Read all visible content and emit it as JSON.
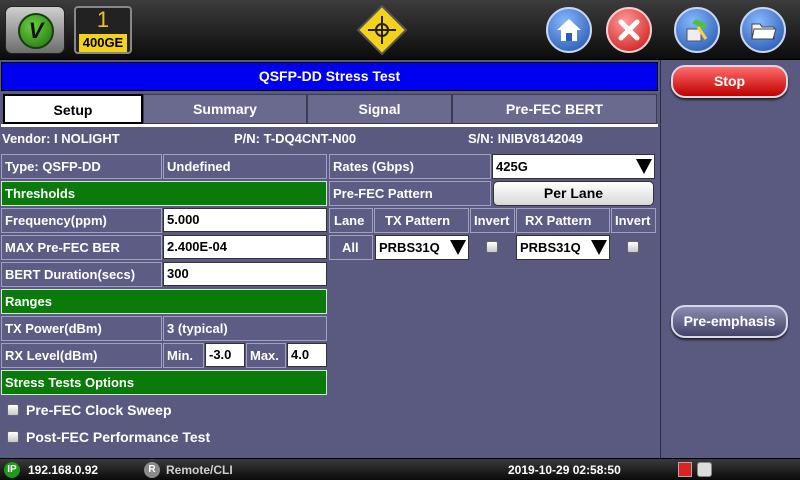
{
  "header": {
    "logo_letter": "V",
    "port_number": "1",
    "port_rate": "400GE"
  },
  "title": "QSFP-DD Stress Test",
  "tabs": [
    {
      "label": "Setup",
      "active": true
    },
    {
      "label": "Summary",
      "active": false
    },
    {
      "label": "Signal",
      "active": false
    },
    {
      "label": "Pre-FEC BERT",
      "active": false
    }
  ],
  "vendor_info": {
    "vendor": "Vendor: I NOLIGHT",
    "pn": "P/N: T-DQ4CNT-N00",
    "sn": "S/N: INIBV8142049"
  },
  "left_panel": {
    "type_label": "Type: QSFP-DD",
    "type_value": "Undefined",
    "thresholds_header": "Thresholds",
    "frequency_label": "Frequency(ppm)",
    "frequency_value": "5.000",
    "max_ber_label": "MAX Pre-FEC BER",
    "max_ber_value": "2.400E-04",
    "bert_duration_label": "BERT Duration(secs)",
    "bert_duration_value": "300",
    "ranges_header": "Ranges",
    "tx_power_label": "TX Power(dBm)",
    "tx_power_value": "3 (typical)",
    "rx_level_label": "RX Level(dBm)",
    "rx_min_label": "Min.",
    "rx_min_value": "-3.0",
    "rx_max_label": "Max.",
    "rx_max_value": "4.0",
    "stress_header": "Stress Tests Options",
    "options": [
      {
        "label": "Pre-FEC Clock Sweep",
        "checked": false
      },
      {
        "label": "Post-FEC Performance Test",
        "checked": false
      }
    ]
  },
  "right_grid": {
    "rates_label": "Rates (Gbps)",
    "rates_value": "425G",
    "pattern_label": "Pre-FEC Pattern",
    "pattern_button": "Per Lane",
    "col_lane": "Lane",
    "col_tx": "TX Pattern",
    "col_invert1": "Invert",
    "col_rx": "RX Pattern",
    "col_invert2": "Invert",
    "row_lane": "All",
    "row_tx": "PRBS31Q",
    "row_rx": "PRBS31Q"
  },
  "side_buttons": {
    "stop": "Stop",
    "preemphasis": "Pre-emphasis"
  },
  "status": {
    "ip_icon": "IP",
    "ip": "192.168.0.92",
    "remote_icon": "R",
    "remote": "Remote/CLI",
    "datetime": "2019-10-29  02:58:50"
  },
  "colors": {
    "title_blue": "#0000f0",
    "header_green": "#0a7a0a",
    "stop_red": "#c00000",
    "panel_bg": "#5a5a80"
  },
  "icons": [
    "home-icon",
    "close-icon",
    "tools-icon",
    "folder-icon",
    "crosshair-icon"
  ]
}
